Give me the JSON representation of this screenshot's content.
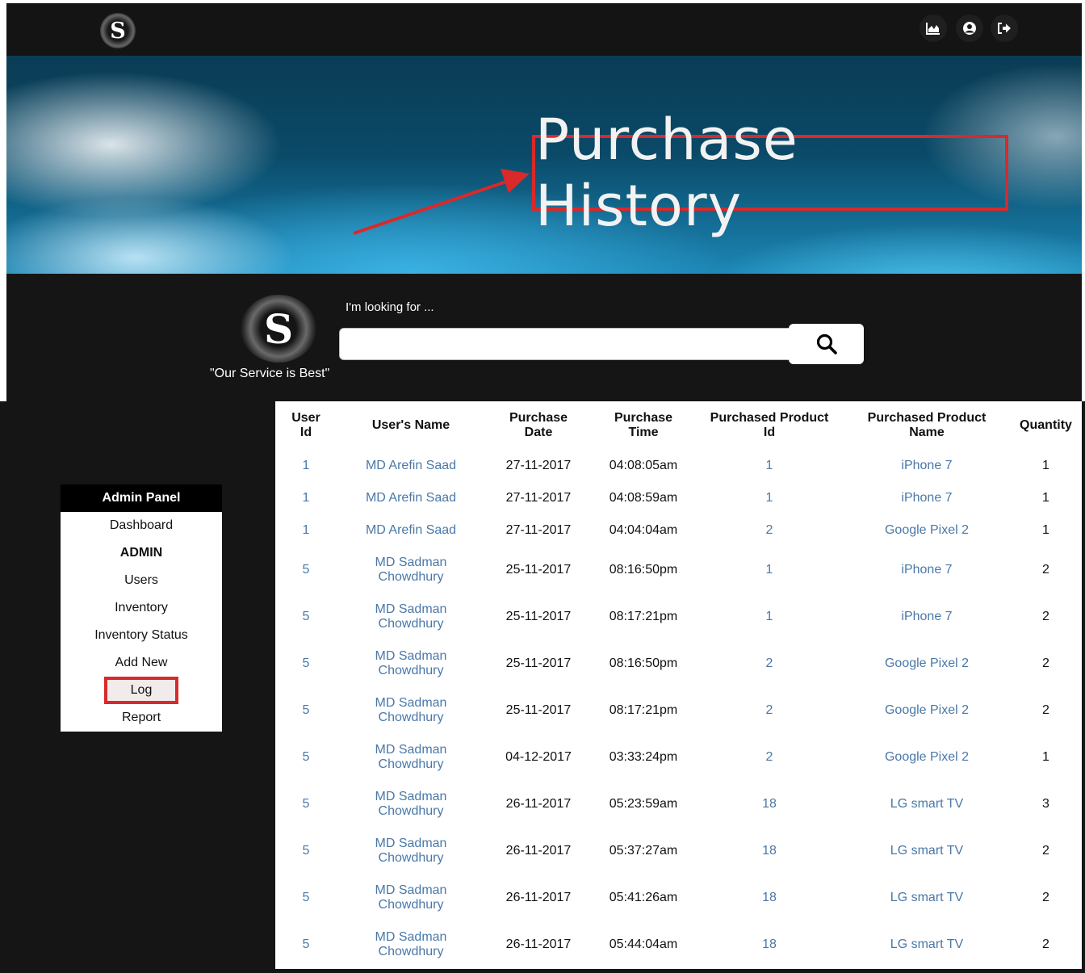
{
  "nav": {
    "logo_letter": "S",
    "icons": [
      "chart-icon",
      "user-icon",
      "logout-icon"
    ]
  },
  "banner": {
    "title": "Purchase History"
  },
  "search": {
    "logo_letter": "S",
    "tagline": "\"Our Service is Best\"",
    "label": "I'm looking for ...",
    "value": "",
    "placeholder": ""
  },
  "admin_panel": {
    "title": "Admin Panel",
    "items": [
      "Dashboard",
      "ADMIN",
      "Users",
      "Inventory",
      "Inventory Status",
      "Add New",
      "Log",
      "Report"
    ]
  },
  "table": {
    "headers": {
      "user_id": [
        "User",
        "Id"
      ],
      "user_name": "User's Name",
      "purchase_date": [
        "Purchase",
        "Date"
      ],
      "purchase_time": [
        "Purchase",
        "Time"
      ],
      "product_id": [
        "Purchased Product",
        "Id"
      ],
      "product_name": [
        "Purchased Product",
        "Name"
      ],
      "quantity": "Quantity"
    },
    "rows": [
      {
        "user_id": "1",
        "name": [
          "MD Arefin Saad"
        ],
        "date": "27-11-2017",
        "time": "04:08:05am",
        "pid": "1",
        "pname": "iPhone 7",
        "qty": "1"
      },
      {
        "user_id": "1",
        "name": [
          "MD Arefin Saad"
        ],
        "date": "27-11-2017",
        "time": "04:08:59am",
        "pid": "1",
        "pname": "iPhone 7",
        "qty": "1"
      },
      {
        "user_id": "1",
        "name": [
          "MD Arefin Saad"
        ],
        "date": "27-11-2017",
        "time": "04:04:04am",
        "pid": "2",
        "pname": "Google Pixel 2",
        "qty": "1"
      },
      {
        "user_id": "5",
        "name": [
          "MD Sadman",
          "Chowdhury"
        ],
        "date": "25-11-2017",
        "time": "08:16:50pm",
        "pid": "1",
        "pname": "iPhone 7",
        "qty": "2"
      },
      {
        "user_id": "5",
        "name": [
          "MD Sadman",
          "Chowdhury"
        ],
        "date": "25-11-2017",
        "time": "08:17:21pm",
        "pid": "1",
        "pname": "iPhone 7",
        "qty": "2"
      },
      {
        "user_id": "5",
        "name": [
          "MD Sadman",
          "Chowdhury"
        ],
        "date": "25-11-2017",
        "time": "08:16:50pm",
        "pid": "2",
        "pname": "Google Pixel 2",
        "qty": "2"
      },
      {
        "user_id": "5",
        "name": [
          "MD Sadman",
          "Chowdhury"
        ],
        "date": "25-11-2017",
        "time": "08:17:21pm",
        "pid": "2",
        "pname": "Google Pixel 2",
        "qty": "2"
      },
      {
        "user_id": "5",
        "name": [
          "MD Sadman",
          "Chowdhury"
        ],
        "date": "04-12-2017",
        "time": "03:33:24pm",
        "pid": "2",
        "pname": "Google Pixel 2",
        "qty": "1"
      },
      {
        "user_id": "5",
        "name": [
          "MD Sadman",
          "Chowdhury"
        ],
        "date": "26-11-2017",
        "time": "05:23:59am",
        "pid": "18",
        "pname": "LG smart TV",
        "qty": "3"
      },
      {
        "user_id": "5",
        "name": [
          "MD Sadman",
          "Chowdhury"
        ],
        "date": "26-11-2017",
        "time": "05:37:27am",
        "pid": "18",
        "pname": "LG smart TV",
        "qty": "2"
      },
      {
        "user_id": "5",
        "name": [
          "MD Sadman",
          "Chowdhury"
        ],
        "date": "26-11-2017",
        "time": "05:41:26am",
        "pid": "18",
        "pname": "LG smart TV",
        "qty": "2"
      },
      {
        "user_id": "5",
        "name": [
          "MD Sadman",
          "Chowdhury"
        ],
        "date": "26-11-2017",
        "time": "05:44:04am",
        "pid": "18",
        "pname": "LG smart TV",
        "qty": "2"
      }
    ]
  },
  "colors": {
    "link": "#4a78a8",
    "highlight_border": "#d9292b",
    "dark_bg": "#151515"
  }
}
